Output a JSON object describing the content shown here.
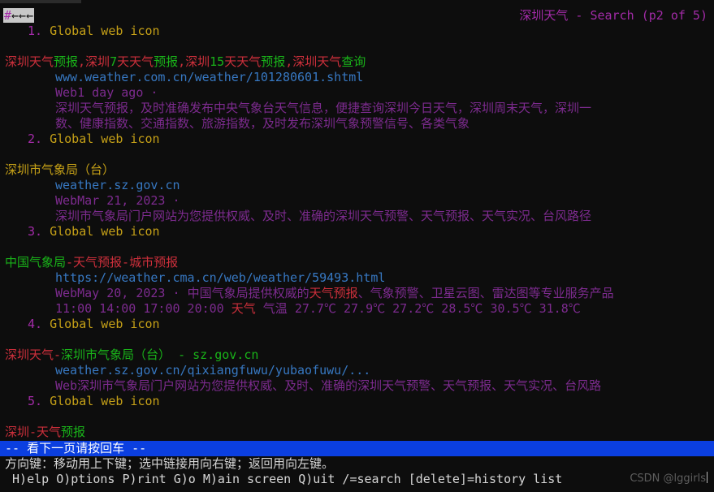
{
  "terminal": {
    "background": "#0d0d0d",
    "browser": "lynx",
    "top_marker": "#",
    "top_marker_arrows": "←←←",
    "header": "深圳天气 - Search (p2 of 5)",
    "colors": {
      "red": "#cc2f3b",
      "green": "#19b319",
      "yellow": "#c5a017",
      "blue": "#3778c2",
      "magenta": "#a32ba8",
      "purple": "#7d2b8f",
      "selection_bg": "#c8c8c8",
      "status_bar_bg": "#0b3fe0"
    }
  },
  "results": [
    {
      "number": "1.",
      "icon_label": "Global web icon",
      "title_parts": [
        {
          "text": "深圳天气",
          "color": "red"
        },
        {
          "text": "预报",
          "color": "green"
        },
        {
          "text": ",深圳",
          "color": "red"
        },
        {
          "text": "7",
          "color": "green"
        },
        {
          "text": "天天气",
          "color": "red"
        },
        {
          "text": "预报",
          "color": "green"
        },
        {
          "text": ",深圳",
          "color": "red"
        },
        {
          "text": "15",
          "color": "green"
        },
        {
          "text": "天天气",
          "color": "red"
        },
        {
          "text": "预报",
          "color": "green"
        },
        {
          "text": ",深圳天气",
          "color": "red"
        },
        {
          "text": "查询",
          "color": "green"
        }
      ],
      "url": "www.weather.com.cn/weather/101280601.shtml",
      "meta": "Web1 day ago ·",
      "description_lines": [
        "深圳天气预报，及时准确发布中央气象台天气信息，便捷查询深圳今日天气，深圳周末天气，深圳一",
        "数、健康指数、交通指数、旅游指数，及时发布深圳气象预警信号、各类气象"
      ]
    },
    {
      "number": "2.",
      "icon_label": "Global web icon",
      "title_parts": [
        {
          "text": "深圳市气象局（台）",
          "color": "yellow"
        }
      ],
      "url": "weather.sz.gov.cn",
      "meta": "WebMar 21, 2023 ·",
      "description_lines": [
        "深圳市气象局门户网站为您提供权威、及时、准确的深圳天气预警、天气预报、天气实况、台风路径"
      ]
    },
    {
      "number": "3.",
      "icon_label": "Global web icon",
      "title_parts": [
        {
          "text": "中国气象局",
          "color": "green"
        },
        {
          "text": "-天气预报-城市预报",
          "color": "red"
        }
      ],
      "url": "https://weather.cma.cn/web/weather/59493.html",
      "meta": "WebMay 20, 2023 ·",
      "description_parts": [
        {
          "text": "中国气象局提供权威的",
          "color": "purple"
        },
        {
          "text": "天气预报",
          "color": "red"
        },
        {
          "text": "、气象预警、卫星云图、雷达图等专业服务产品",
          "color": "purple"
        }
      ],
      "data_line_parts": [
        {
          "text": "11:00 14:00 17:00 20:00 ",
          "color": "purple"
        },
        {
          "text": "天气",
          "color": "red"
        },
        {
          "text": " 气温 27.7℃ 27.9℃ 27.2℃ 28.5℃ 30.5℃ 31.8℃",
          "color": "purple"
        }
      ]
    },
    {
      "number": "4.",
      "icon_label": "Global web icon",
      "title_parts": [
        {
          "text": "深圳天气-",
          "color": "red"
        },
        {
          "text": "深圳市气象局（台） - sz.gov.cn",
          "color": "green"
        }
      ],
      "url": "weather.sz.gov.cn/qixiangfuwu/yubaofuwu/...",
      "meta": "Web",
      "description_lines": [
        "深圳市气象局门户网站为您提供权威、及时、准确的深圳天气预警、天气预报、天气实况、台风路"
      ]
    },
    {
      "number": "5.",
      "icon_label": "Global web icon",
      "title_parts": [
        {
          "text": "深圳-天气",
          "color": "red"
        },
        {
          "text": "预报",
          "color": "green"
        }
      ]
    }
  ],
  "status_bar": {
    "text": "-- 看下一页请按回车 --"
  },
  "footer": {
    "hint": "方向键：移动用上下键；选中链接用向右键；返回用向左键。",
    "commands": " H)elp O)ptions P)rint G)o M)ain screen Q)uit /=search [delete]=history list"
  },
  "watermark": {
    "text": "CSDN @lggirls"
  }
}
